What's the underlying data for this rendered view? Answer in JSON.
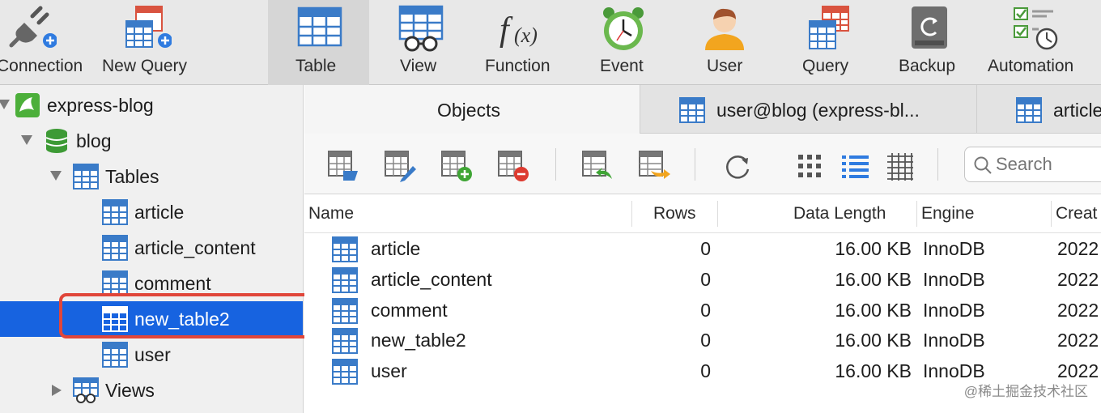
{
  "toolbar": {
    "items": [
      {
        "label": "Connection",
        "icon": "plug-add-icon"
      },
      {
        "label": "New Query",
        "icon": "new-query-icon"
      },
      {
        "label": "Table",
        "icon": "table-icon",
        "active": true
      },
      {
        "label": "View",
        "icon": "view-icon"
      },
      {
        "label": "Function",
        "icon": "function-icon"
      },
      {
        "label": "Event",
        "icon": "clock-icon"
      },
      {
        "label": "User",
        "icon": "user-icon"
      },
      {
        "label": "Query",
        "icon": "query-icon"
      },
      {
        "label": "Backup",
        "icon": "backup-icon"
      },
      {
        "label": "Automation",
        "icon": "automation-icon"
      }
    ]
  },
  "sidebar": {
    "connection": "express-blog",
    "database": "blog",
    "tables_label": "Tables",
    "tables": [
      "article",
      "article_content",
      "comment",
      "new_table2",
      "user"
    ],
    "selected": "new_table2",
    "views_label": "Views"
  },
  "tabs": [
    {
      "label": "Objects",
      "active": true
    },
    {
      "label": "user@blog (express-bl..."
    },
    {
      "label": "article"
    }
  ],
  "search": {
    "placeholder": "Search"
  },
  "grid": {
    "columns": [
      "Name",
      "Rows",
      "Data Length",
      "Engine",
      "Creat"
    ],
    "rows": [
      {
        "name": "article",
        "rows": "0",
        "data_length": "16.00 KB",
        "engine": "InnoDB",
        "created": "2022"
      },
      {
        "name": "article_content",
        "rows": "0",
        "data_length": "16.00 KB",
        "engine": "InnoDB",
        "created": "2022"
      },
      {
        "name": "comment",
        "rows": "0",
        "data_length": "16.00 KB",
        "engine": "InnoDB",
        "created": "2022"
      },
      {
        "name": "new_table2",
        "rows": "0",
        "data_length": "16.00 KB",
        "engine": "InnoDB",
        "created": "2022"
      },
      {
        "name": "user",
        "rows": "0",
        "data_length": "16.00 KB",
        "engine": "InnoDB",
        "created": "2022"
      }
    ]
  },
  "watermark": "@稀土掘金技术社区",
  "colors": {
    "accent": "#1763e0",
    "highlight": "#e0463a",
    "table_icon": "#3a7bc8"
  }
}
